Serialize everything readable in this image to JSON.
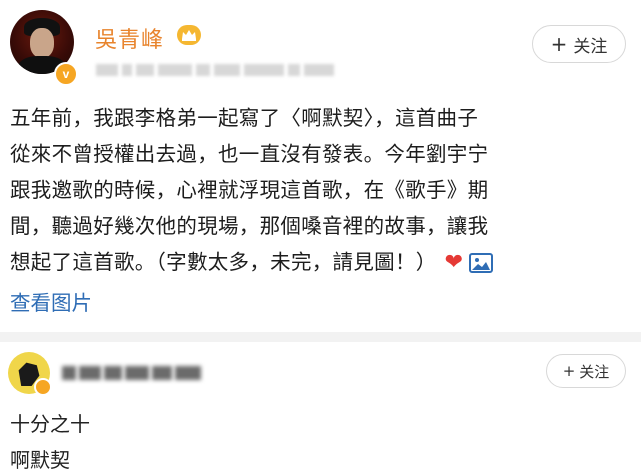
{
  "post": {
    "author": {
      "name": "吳青峰",
      "avatar_icon": "user-avatar",
      "verified_badge": "v",
      "crown_icon": "crown-icon",
      "name_color": "#e8842d"
    },
    "follow_label": "关注",
    "follow_icon": "+",
    "content_lines": [
      "五年前，我跟李格弟一起寫了〈啊默契〉，這首曲子",
      "從來不曾授權出去過，也一直沒有發表。今年劉宇宁",
      "跟我邀歌的時候，心裡就浮現這首歌，在《歌手》期",
      "間，聽過好幾次他的現場，那個嗓音裡的故事，讓我",
      "想起了這首歌。（字數太多，未完，請見圖！）"
    ],
    "heart_icon": "❤",
    "image_icon": "image-icon",
    "view_pics_label": "查看图片",
    "link_color": "#2f6db5"
  },
  "comment": {
    "follow_label": "关注",
    "follow_icon": "+",
    "lines": [
      "十分之十",
      "啊默契"
    ]
  }
}
